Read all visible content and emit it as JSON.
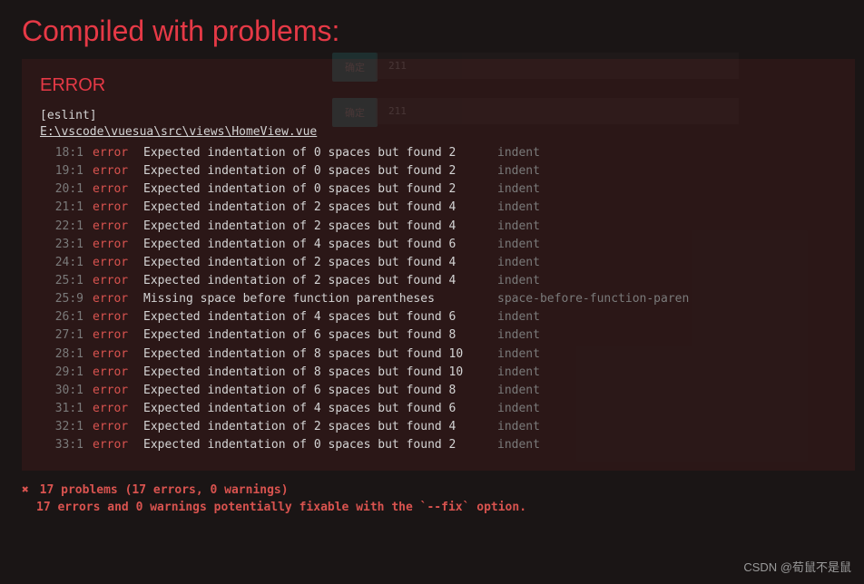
{
  "page_title": "Compiled with problems:",
  "bg": {
    "btn1_label": "确定",
    "input1_value": "211",
    "btn2_label": "确定",
    "input2_value": "211"
  },
  "error_panel": {
    "title": "ERROR",
    "tool": "[eslint]",
    "file": "E:\\vscode\\vuesua\\src\\views\\HomeView.vue",
    "rows": [
      {
        "loc": "18:1",
        "level": "error",
        "msg": "Expected indentation of 0 spaces but found 2",
        "rule": "indent"
      },
      {
        "loc": "19:1",
        "level": "error",
        "msg": "Expected indentation of 0 spaces but found 2",
        "rule": "indent"
      },
      {
        "loc": "20:1",
        "level": "error",
        "msg": "Expected indentation of 0 spaces but found 2",
        "rule": "indent"
      },
      {
        "loc": "21:1",
        "level": "error",
        "msg": "Expected indentation of 2 spaces but found 4",
        "rule": "indent"
      },
      {
        "loc": "22:1",
        "level": "error",
        "msg": "Expected indentation of 2 spaces but found 4",
        "rule": "indent"
      },
      {
        "loc": "23:1",
        "level": "error",
        "msg": "Expected indentation of 4 spaces but found 6",
        "rule": "indent"
      },
      {
        "loc": "24:1",
        "level": "error",
        "msg": "Expected indentation of 2 spaces but found 4",
        "rule": "indent"
      },
      {
        "loc": "25:1",
        "level": "error",
        "msg": "Expected indentation of 2 spaces but found 4",
        "rule": "indent"
      },
      {
        "loc": "25:9",
        "level": "error",
        "msg": "Missing space before function parentheses",
        "rule": "space-before-function-paren"
      },
      {
        "loc": "26:1",
        "level": "error",
        "msg": "Expected indentation of 4 spaces but found 6",
        "rule": "indent"
      },
      {
        "loc": "27:1",
        "level": "error",
        "msg": "Expected indentation of 6 spaces but found 8",
        "rule": "indent"
      },
      {
        "loc": "28:1",
        "level": "error",
        "msg": "Expected indentation of 8 spaces but found 10",
        "rule": "indent"
      },
      {
        "loc": "29:1",
        "level": "error",
        "msg": "Expected indentation of 8 spaces but found 10",
        "rule": "indent"
      },
      {
        "loc": "30:1",
        "level": "error",
        "msg": "Expected indentation of 6 spaces but found 8",
        "rule": "indent"
      },
      {
        "loc": "31:1",
        "level": "error",
        "msg": "Expected indentation of 4 spaces but found 6",
        "rule": "indent"
      },
      {
        "loc": "32:1",
        "level": "error",
        "msg": "Expected indentation of 2 spaces but found 4",
        "rule": "indent"
      },
      {
        "loc": "33:1",
        "level": "error",
        "msg": "Expected indentation of 0 spaces but found 2",
        "rule": "indent"
      }
    ]
  },
  "summary": {
    "x": "✖",
    "line1": "17 problems (17 errors, 0 warnings)",
    "line2": "17 errors and 0 warnings potentially fixable with the `--fix` option."
  },
  "watermark": "CSDN @荀鼠不是鼠"
}
